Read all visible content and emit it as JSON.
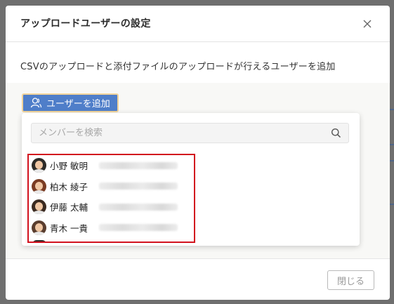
{
  "dialog": {
    "title": "アップロードユーザーの設定",
    "description": "CSVのアップロードと添付ファイルのアップロードが行えるユーザーを追加",
    "add_user_label": "ユーザーを追加",
    "close_label": "閉じる",
    "accent_color": "#4f7ec9",
    "highlight_color": "#d2121e"
  },
  "search": {
    "placeholder": "メンバーを検索",
    "value": ""
  },
  "members": [
    {
      "name": "小野 敏明",
      "email_visible": false
    },
    {
      "name": "柏木 綾子",
      "email_visible": false
    },
    {
      "name": "伊藤 太輔",
      "email_visible": false
    },
    {
      "name": "青木 一貴",
      "email_visible": false
    }
  ],
  "icons": {
    "close": "close-icon",
    "add_user": "user-add-icon",
    "search": "search-icon"
  }
}
